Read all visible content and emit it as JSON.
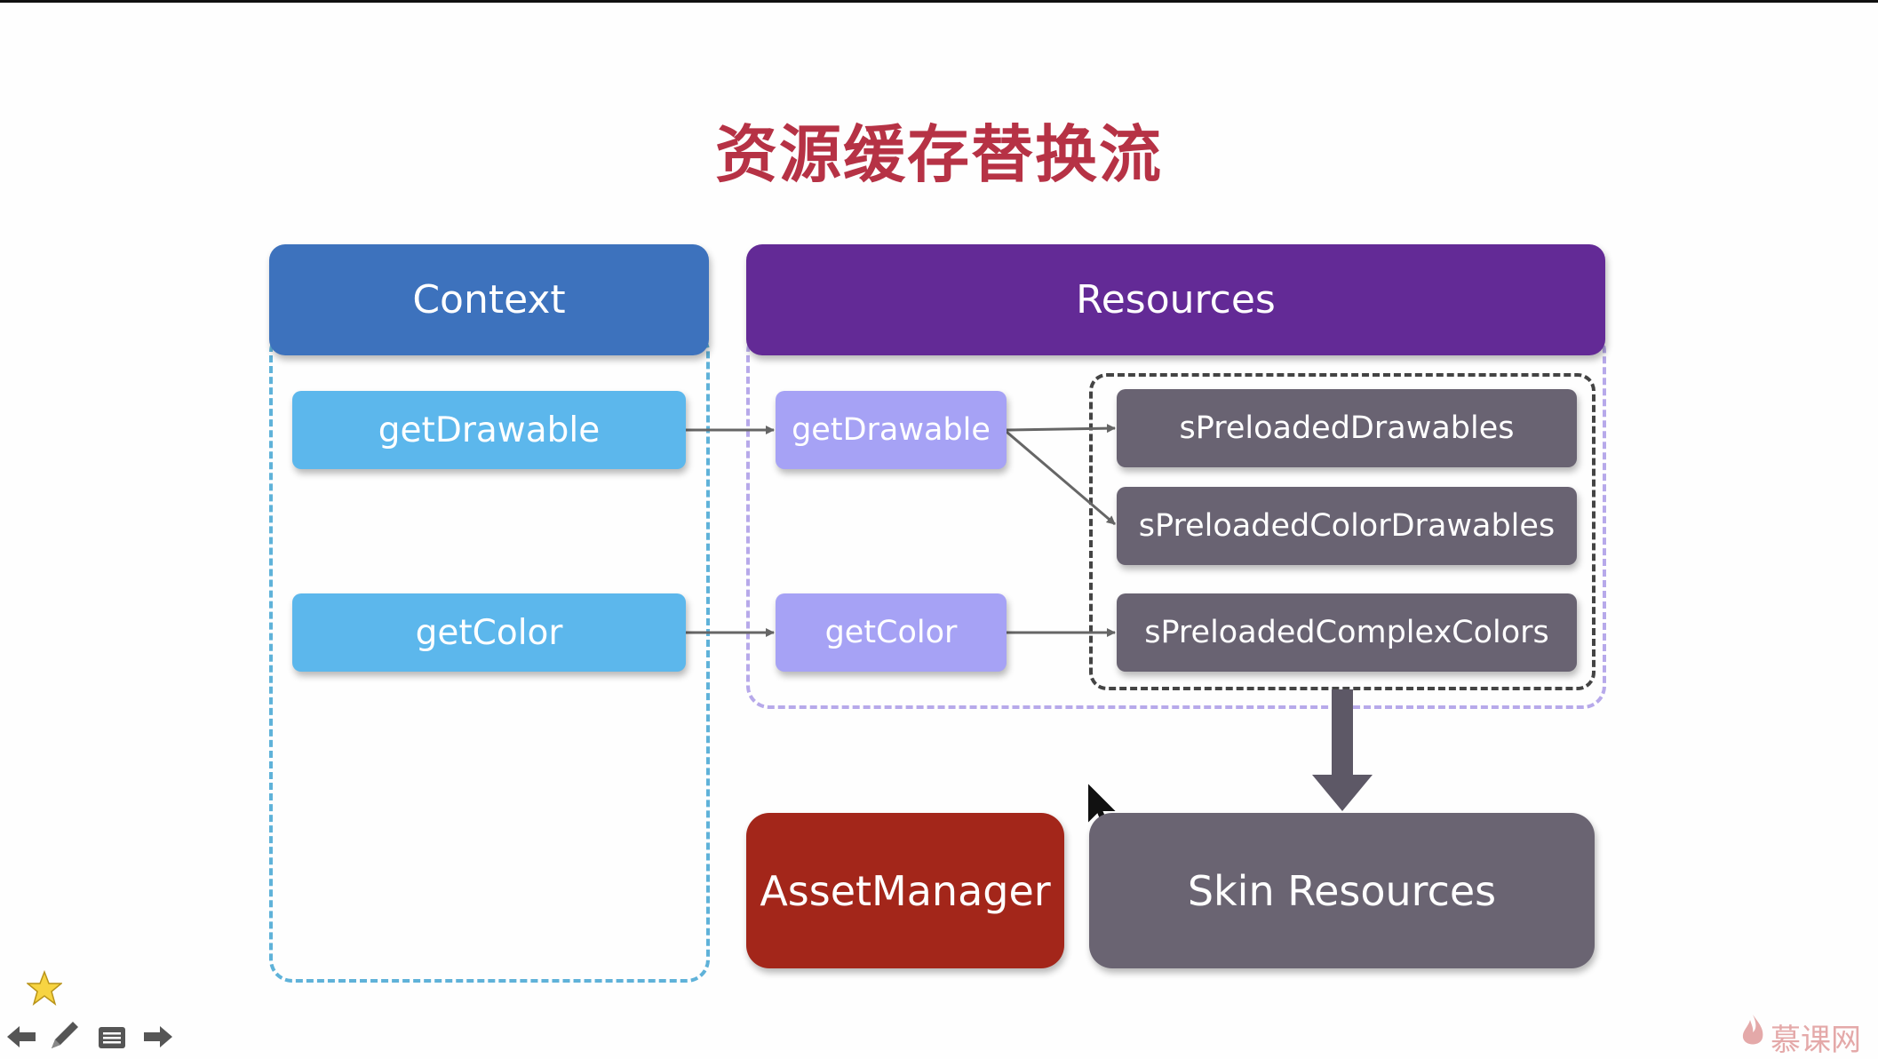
{
  "title": "资源缓存替换流",
  "context": {
    "header": "Context",
    "methods": [
      "getDrawable",
      "getColor"
    ]
  },
  "resources": {
    "header": "Resources",
    "methods": [
      "getDrawable",
      "getColor"
    ]
  },
  "cache": {
    "items": [
      "sPreloadedDrawables",
      "sPreloadedColorDrawables",
      "sPreloadedComplexColors"
    ]
  },
  "bottom": {
    "asset_manager": "AssetManager",
    "skin_resources": "Skin Resources"
  },
  "watermark": "慕课网",
  "toolbar": {
    "icons": [
      "star-icon",
      "prev-arrow-icon",
      "pen-icon",
      "menu-icon",
      "next-arrow-icon"
    ]
  },
  "colors": {
    "title": "#b63245",
    "context_header": "#3d72bd",
    "resources_header": "#632a96",
    "context_method": "#5cb7ec",
    "resources_method": "#a6a2f5",
    "cache_item": "#696372",
    "asset_manager": "#a3261a",
    "skin_resources": "#6a6472"
  }
}
